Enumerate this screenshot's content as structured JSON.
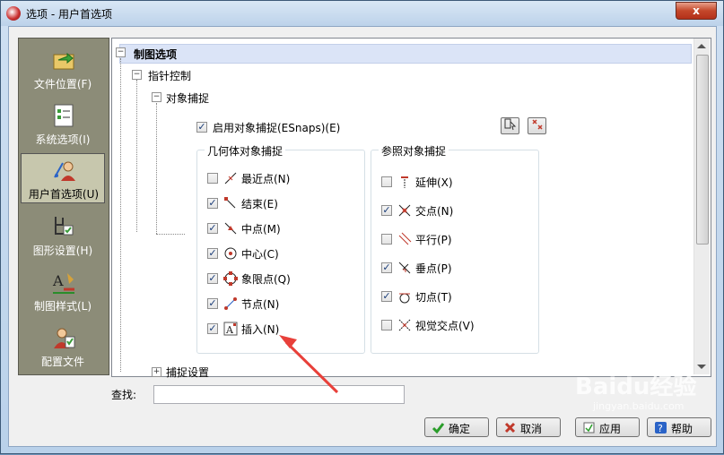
{
  "window": {
    "title": "选项 - 用户首选项",
    "close_symbol": "x"
  },
  "sidebar": {
    "items": [
      {
        "label": "文件位置(F)",
        "icon": "folder-arrow-icon",
        "selected": false
      },
      {
        "label": "系统选项(I)",
        "icon": "checklist-icon",
        "selected": false
      },
      {
        "label": "用户首选项(U)",
        "icon": "user-preferences-icon",
        "selected": true
      },
      {
        "label": "图形设置(H)",
        "icon": "graphic-settings-icon",
        "selected": false
      },
      {
        "label": "制图样式(L)",
        "icon": "drafting-style-icon",
        "selected": false
      },
      {
        "label": "配置文件",
        "icon": "profile-icon",
        "selected": false
      }
    ]
  },
  "tree": {
    "root_label": "制图选项",
    "pointer_control": "指针控制",
    "object_snap": "对象捕捉",
    "enable_snap_label": "启用对象捕捉(ESnaps)(E)",
    "enable_snap_checked": true,
    "snap_settings": "捕捉设置",
    "geometric_group": {
      "title": "几何体对象捕捉",
      "items": [
        {
          "label": "最近点(N)",
          "checked": false,
          "icon": "nearest-icon"
        },
        {
          "label": "结束(E)",
          "checked": true,
          "icon": "endpoint-icon"
        },
        {
          "label": "中点(M)",
          "checked": true,
          "icon": "midpoint-icon"
        },
        {
          "label": "中心(C)",
          "checked": true,
          "icon": "center-icon"
        },
        {
          "label": "象限点(Q)",
          "checked": true,
          "icon": "quadrant-icon"
        },
        {
          "label": "节点(N)",
          "checked": true,
          "icon": "node-icon"
        },
        {
          "label": "插入(N)",
          "checked": true,
          "icon": "insert-icon"
        }
      ]
    },
    "reference_group": {
      "title": "参照对象捕捉",
      "items": [
        {
          "label": "延伸(X)",
          "checked": false,
          "icon": "extension-icon"
        },
        {
          "label": "交点(N)",
          "checked": true,
          "icon": "intersection-icon"
        },
        {
          "label": "平行(P)",
          "checked": false,
          "icon": "parallel-icon"
        },
        {
          "label": "垂点(P)",
          "checked": true,
          "icon": "perpendicular-icon"
        },
        {
          "label": "切点(T)",
          "checked": true,
          "icon": "tangent-icon"
        },
        {
          "label": "视觉交点(V)",
          "checked": false,
          "icon": "apparent-intersection-icon"
        }
      ]
    }
  },
  "search": {
    "label": "查找:",
    "value": ""
  },
  "buttons": {
    "ok": "确定",
    "cancel": "取消",
    "apply": "应用",
    "help": "帮助"
  },
  "watermark": {
    "text": "Baidu经验",
    "url": "jingyan.baidu.com"
  },
  "colors": {
    "annotation_arrow": "#e8403a",
    "selected_sidebar": "#c7c7ad",
    "sidebar_bg": "#8c8c78"
  }
}
